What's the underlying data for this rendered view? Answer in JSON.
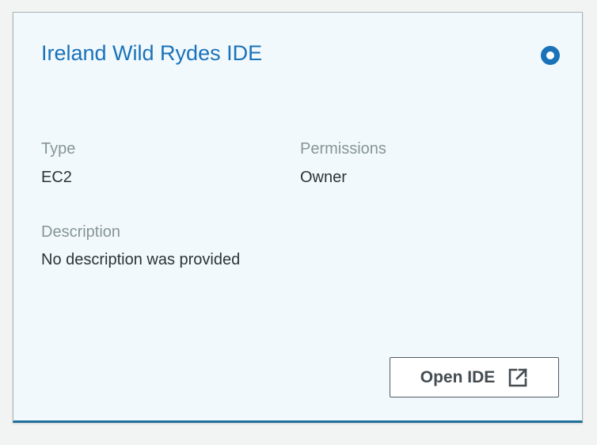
{
  "environment": {
    "title": "Ireland Wild Rydes IDE",
    "type_label": "Type",
    "type_value": "EC2",
    "permissions_label": "Permissions",
    "permissions_value": "Owner",
    "description_label": "Description",
    "description_value": "No description was provided",
    "open_button_label": "Open IDE",
    "selected": true
  },
  "icons": {
    "select": "radio-selected-icon",
    "open": "external-link-icon"
  },
  "colors": {
    "accent": "#1a72b8",
    "card_background": "#f1f9fd",
    "page_background": "#f2f3f3",
    "label_text": "#879596",
    "value_text": "#2c3438"
  }
}
